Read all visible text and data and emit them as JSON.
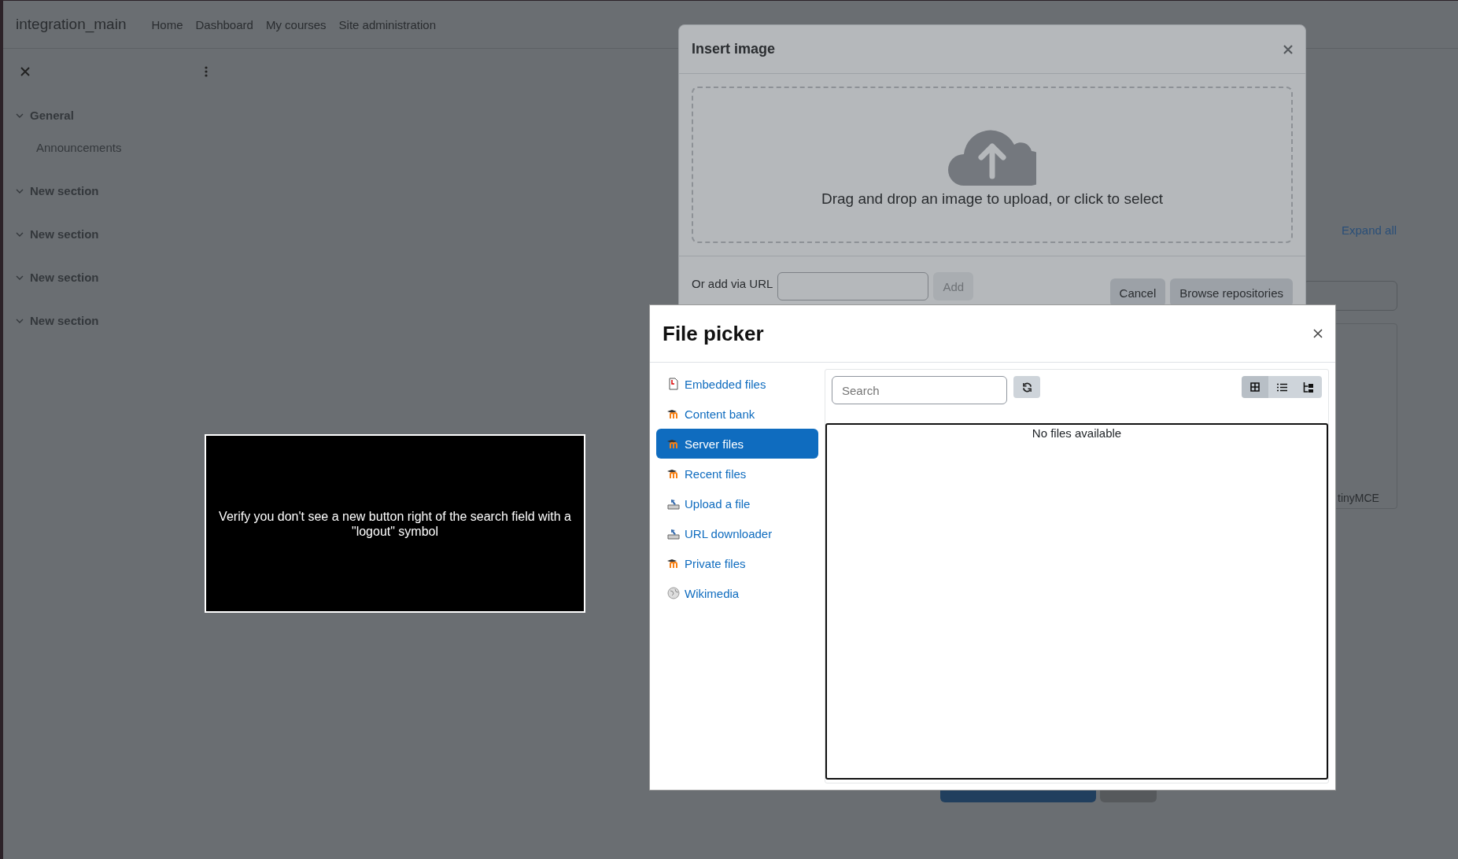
{
  "navbar": {
    "brand": "integration_main",
    "links": [
      "Home",
      "Dashboard",
      "My courses",
      "Site administration"
    ]
  },
  "course_index": {
    "sections": [
      {
        "title": "General",
        "expanded": true,
        "items": [
          "Announcements"
        ]
      },
      {
        "title": "New section",
        "expanded": true
      },
      {
        "title": "New section",
        "expanded": true
      },
      {
        "title": "New section",
        "expanded": true
      },
      {
        "title": "New section",
        "expanded": true
      }
    ]
  },
  "page": {
    "expand_all": "Expand all",
    "editor_brand": "tinyMCE",
    "footer_buttons": [
      {
        "kind": "primary"
      },
      {
        "kind": "secondary"
      }
    ]
  },
  "insert_image": {
    "title": "Insert image",
    "dropzone_text": "Drag and drop an image to upload, or click to select",
    "url_label": "Or add via URL",
    "add_button": {
      "label": "Add",
      "disabled": true
    },
    "buttons": [
      "Cancel",
      "Browse repositories"
    ]
  },
  "file_picker": {
    "title": "File picker",
    "repositories": [
      {
        "label": "Embedded files",
        "kind": "document",
        "selected": false
      },
      {
        "label": "Content bank",
        "kind": "moodle",
        "selected": false
      },
      {
        "label": "Server files",
        "kind": "moodle",
        "selected": true
      },
      {
        "label": "Recent files",
        "kind": "moodle",
        "selected": false
      },
      {
        "label": "Upload a file",
        "kind": "upload",
        "selected": false
      },
      {
        "label": "URL downloader",
        "kind": "upload",
        "selected": false
      },
      {
        "label": "Private files",
        "kind": "moodle",
        "selected": false
      },
      {
        "label": "Wikimedia",
        "kind": "globe",
        "selected": false
      }
    ],
    "search": {
      "placeholder": "Search"
    },
    "views": [
      {
        "kind": "icons",
        "selected": true
      },
      {
        "kind": "list",
        "selected": false
      },
      {
        "kind": "tree",
        "selected": false
      }
    ],
    "empty_message": "No files available"
  },
  "overlay_message": {
    "text": "Verify you don't see a new button right of the search field with a \"logout\" symbol"
  }
}
